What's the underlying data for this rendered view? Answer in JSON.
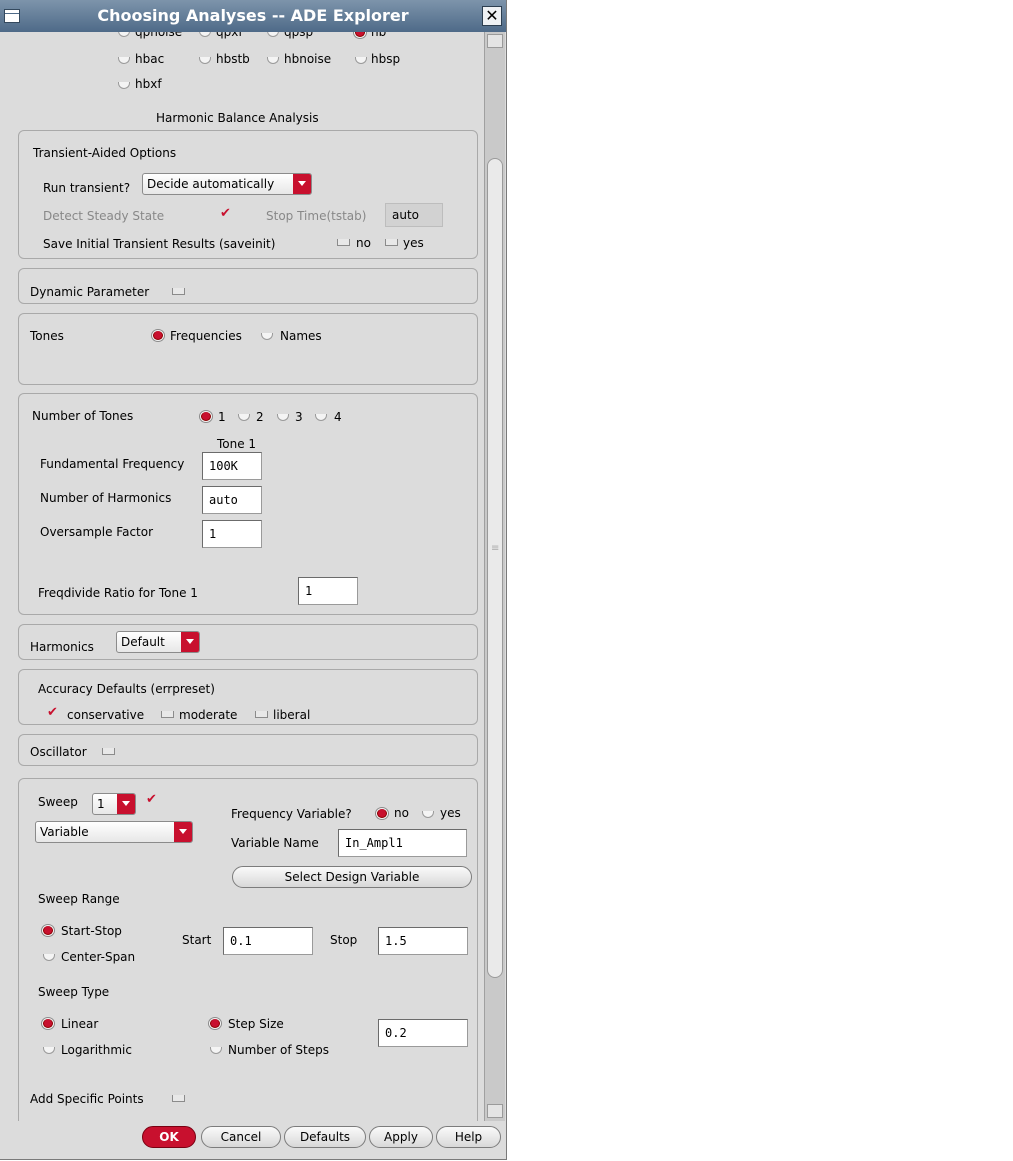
{
  "window": {
    "title": "Choosing Analyses -- ADE Explorer"
  },
  "analysis_types": {
    "row0": [
      "qpnoise",
      "qpxf",
      "qpsp",
      "hb"
    ],
    "row1": [
      "hbac",
      "hbstb",
      "hbnoise",
      "hbsp"
    ],
    "row2": [
      "hbxf"
    ]
  },
  "section_title": "Harmonic Balance Analysis",
  "transient": {
    "title": "Transient-Aided Options",
    "run_label": "Run transient?",
    "run_value": "Decide automatically",
    "detect_label": "Detect Steady State",
    "stop_label": "Stop Time(tstab)",
    "stop_value": "auto",
    "saveinit_label": "Save Initial Transient Results (saveinit)",
    "no": "no",
    "yes": "yes"
  },
  "dynamic_parameter": "Dynamic Parameter",
  "tones": {
    "label": "Tones",
    "frequencies": "Frequencies",
    "names": "Names"
  },
  "num_tones": {
    "label": "Number of Tones",
    "options": [
      "1",
      "2",
      "3",
      "4"
    ],
    "tone_header": "Tone 1",
    "fund_label": "Fundamental Frequency",
    "fund_value": "100K",
    "harm_label": "Number of Harmonics",
    "harm_value": "auto",
    "over_label": "Oversample Factor",
    "over_value": "1",
    "freqdiv_label": "Freqdivide Ratio for Tone 1",
    "freqdiv_value": "1"
  },
  "harmonics": {
    "label": "Harmonics",
    "value": "Default"
  },
  "accuracy": {
    "title": "Accuracy Defaults (errpreset)",
    "conservative": "conservative",
    "moderate": "moderate",
    "liberal": "liberal"
  },
  "oscillator": "Oscillator",
  "sweep": {
    "label": "Sweep",
    "count": "1",
    "type_value": "Variable",
    "freqvar_label": "Frequency Variable?",
    "no": "no",
    "yes": "yes",
    "varname_label": "Variable Name",
    "varname_value": "In_Ampl1",
    "select_button": "Select Design Variable",
    "range_label": "Sweep Range",
    "start_stop": "Start-Stop",
    "center_span": "Center-Span",
    "start_label": "Start",
    "start_value": "0.1",
    "stop_label": "Stop",
    "stop_value": "1.5",
    "type_label": "Sweep Type",
    "linear": "Linear",
    "logarithmic": "Logarithmic",
    "step_size": "Step Size",
    "num_steps": "Number of Steps",
    "step_value": "0.2",
    "add_points": "Add Specific Points"
  },
  "buttons": {
    "ok": "OK",
    "cancel": "Cancel",
    "defaults": "Defaults",
    "apply": "Apply",
    "help": "Help"
  },
  "colors": {
    "accent": "#c8102e",
    "titlebar": "#4e6a88",
    "panel": "#dcdcdc"
  }
}
